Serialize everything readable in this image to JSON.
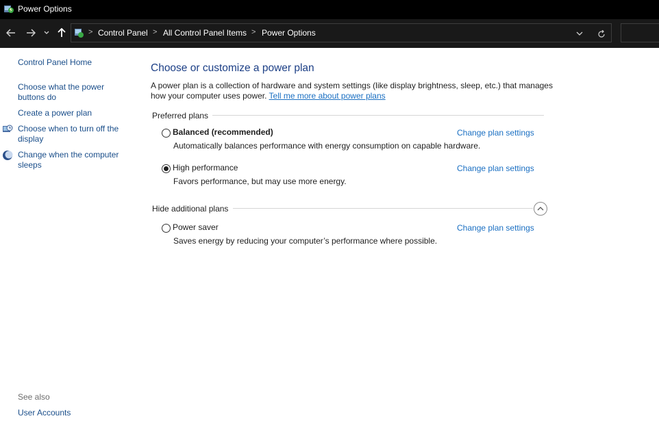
{
  "window": {
    "title": "Power Options"
  },
  "navigation": {
    "back_icon": "back-arrow-icon",
    "forward_icon": "forward-arrow-icon",
    "recent_icon": "chevron-down-icon",
    "up_icon": "up-arrow-icon",
    "breadcrumbs": [
      "Control Panel",
      "All Control Panel Items",
      "Power Options"
    ],
    "separator": ">",
    "dropdown_icon": "chevron-down-icon",
    "refresh_icon": "refresh-icon"
  },
  "sidebar": {
    "home_link": "Control Panel Home",
    "links": [
      "Choose what the power buttons do",
      "Create a power plan",
      "Choose when to turn off the display",
      "Change when the computer sleeps"
    ],
    "see_also_label": "See also",
    "see_also_links": [
      "User Accounts"
    ]
  },
  "main": {
    "title": "Choose or customize a power plan",
    "intro_text": "A power plan is a collection of hardware and system settings (like display brightness, sleep, etc.) that manages how your computer uses power.",
    "intro_link": "Tell me more about power plans",
    "preferred_plans_label": "Preferred plans",
    "hide_additional_label": "Hide additional plans",
    "change_link_label": "Change plan settings",
    "plans": [
      {
        "name": "Balanced (recommended)",
        "description": "Automatically balances performance with energy consumption on capable hardware.",
        "selected": false
      },
      {
        "name": "High performance",
        "description": "Favors performance, but may use more energy.",
        "selected": true
      },
      {
        "name": "Power saver",
        "description": "Saves energy by reducing your computer’s performance where possible.",
        "selected": false
      }
    ]
  },
  "colors": {
    "link": "#1a4e8a",
    "hyperlink": "#1a6fc2",
    "title": "#1c3f86",
    "titlebar_bg": "#000000",
    "addressbar_bg": "#191919"
  }
}
